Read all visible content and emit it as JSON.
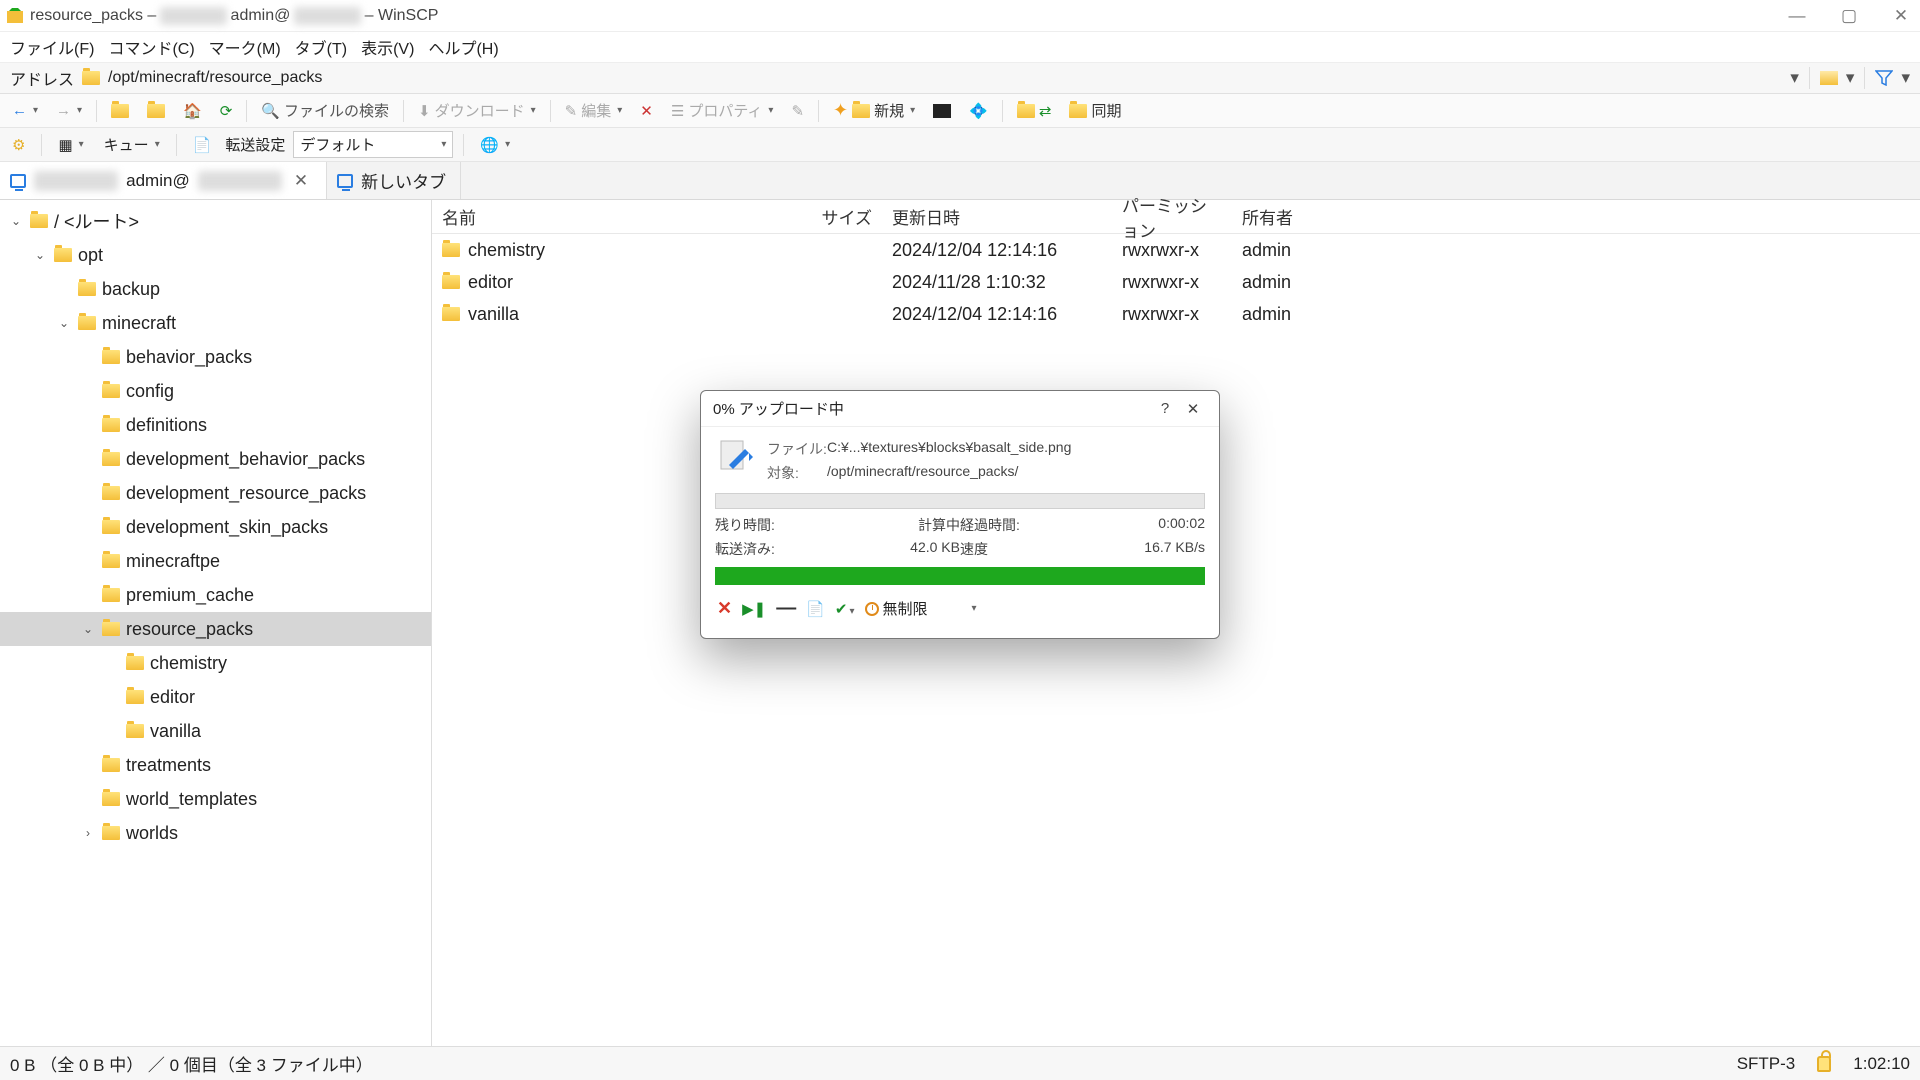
{
  "titlebar": {
    "left": "resource_packs –",
    "mid": "admin@",
    "right": "– WinSCP"
  },
  "menu": {
    "file": "ファイル(F)",
    "command": "コマンド(C)",
    "mark": "マーク(M)",
    "tab": "タブ(T)",
    "view": "表示(V)",
    "help": "ヘルプ(H)"
  },
  "address": {
    "label": "アドレス",
    "path": "/opt/minecraft/resource_packs"
  },
  "toolbar": {
    "search": "ファイルの検索",
    "download": "ダウンロード",
    "edit": "編集",
    "property": "プロパティ",
    "newbtn": "新規",
    "sync": "同期"
  },
  "toolbar2": {
    "queue": "キュー",
    "transfer": "転送設定",
    "default": "デフォルト"
  },
  "sessiontabs": {
    "admin_prefix": "admin@",
    "newtab": "新しいタブ"
  },
  "tree": [
    {
      "depth": 0,
      "name": "/ <ルート>",
      "toggle": "v"
    },
    {
      "depth": 1,
      "name": "opt",
      "toggle": "v"
    },
    {
      "depth": 2,
      "name": "backup",
      "toggle": ""
    },
    {
      "depth": 2,
      "name": "minecraft",
      "toggle": "v"
    },
    {
      "depth": 3,
      "name": "behavior_packs",
      "toggle": ""
    },
    {
      "depth": 3,
      "name": "config",
      "toggle": ""
    },
    {
      "depth": 3,
      "name": "definitions",
      "toggle": ""
    },
    {
      "depth": 3,
      "name": "development_behavior_packs",
      "toggle": ""
    },
    {
      "depth": 3,
      "name": "development_resource_packs",
      "toggle": ""
    },
    {
      "depth": 3,
      "name": "development_skin_packs",
      "toggle": ""
    },
    {
      "depth": 3,
      "name": "minecraftpe",
      "toggle": ""
    },
    {
      "depth": 3,
      "name": "premium_cache",
      "toggle": ""
    },
    {
      "depth": 3,
      "name": "resource_packs",
      "toggle": "v",
      "selected": true
    },
    {
      "depth": 4,
      "name": "chemistry",
      "toggle": ""
    },
    {
      "depth": 4,
      "name": "editor",
      "toggle": ""
    },
    {
      "depth": 4,
      "name": "vanilla",
      "toggle": ""
    },
    {
      "depth": 3,
      "name": "treatments",
      "toggle": ""
    },
    {
      "depth": 3,
      "name": "world_templates",
      "toggle": ""
    },
    {
      "depth": 3,
      "name": "worlds",
      "toggle": ">"
    }
  ],
  "columns": {
    "name": "名前",
    "size": "サイズ",
    "updated": "更新日時",
    "perm": "パーミッション",
    "owner": "所有者"
  },
  "files": [
    {
      "name": "chemistry",
      "size": "",
      "updated": "2024/12/04 12:14:16",
      "perm": "rwxrwxr-x",
      "owner": "admin"
    },
    {
      "name": "editor",
      "size": "",
      "updated": "2024/11/28 1:10:32",
      "perm": "rwxrwxr-x",
      "owner": "admin"
    },
    {
      "name": "vanilla",
      "size": "",
      "updated": "2024/12/04 12:14:16",
      "perm": "rwxrwxr-x",
      "owner": "admin"
    }
  ],
  "statusbar": {
    "left": "0 B （全 0 B 中） ／ 0 個目（全 3 ファイル中）",
    "protocol": "SFTP-3",
    "time": "1:02:10"
  },
  "dialog": {
    "title": "0% アップロード中",
    "file_label": "ファイル:",
    "file_value": "C:¥...¥textures¥blocks¥basalt_side.png",
    "target_label": "対象:",
    "target_value": "/opt/minecraft/resource_packs/",
    "remaining_label": "残り時間:",
    "remaining_value": "計算中",
    "elapsed_label": "経過時間:",
    "elapsed_value": "0:00:02",
    "transferred_label": "転送済み:",
    "transferred_value": "42.0 KB",
    "speed_label": "速度",
    "speed_value": "16.7 KB/s",
    "unlimited": "無制限"
  }
}
